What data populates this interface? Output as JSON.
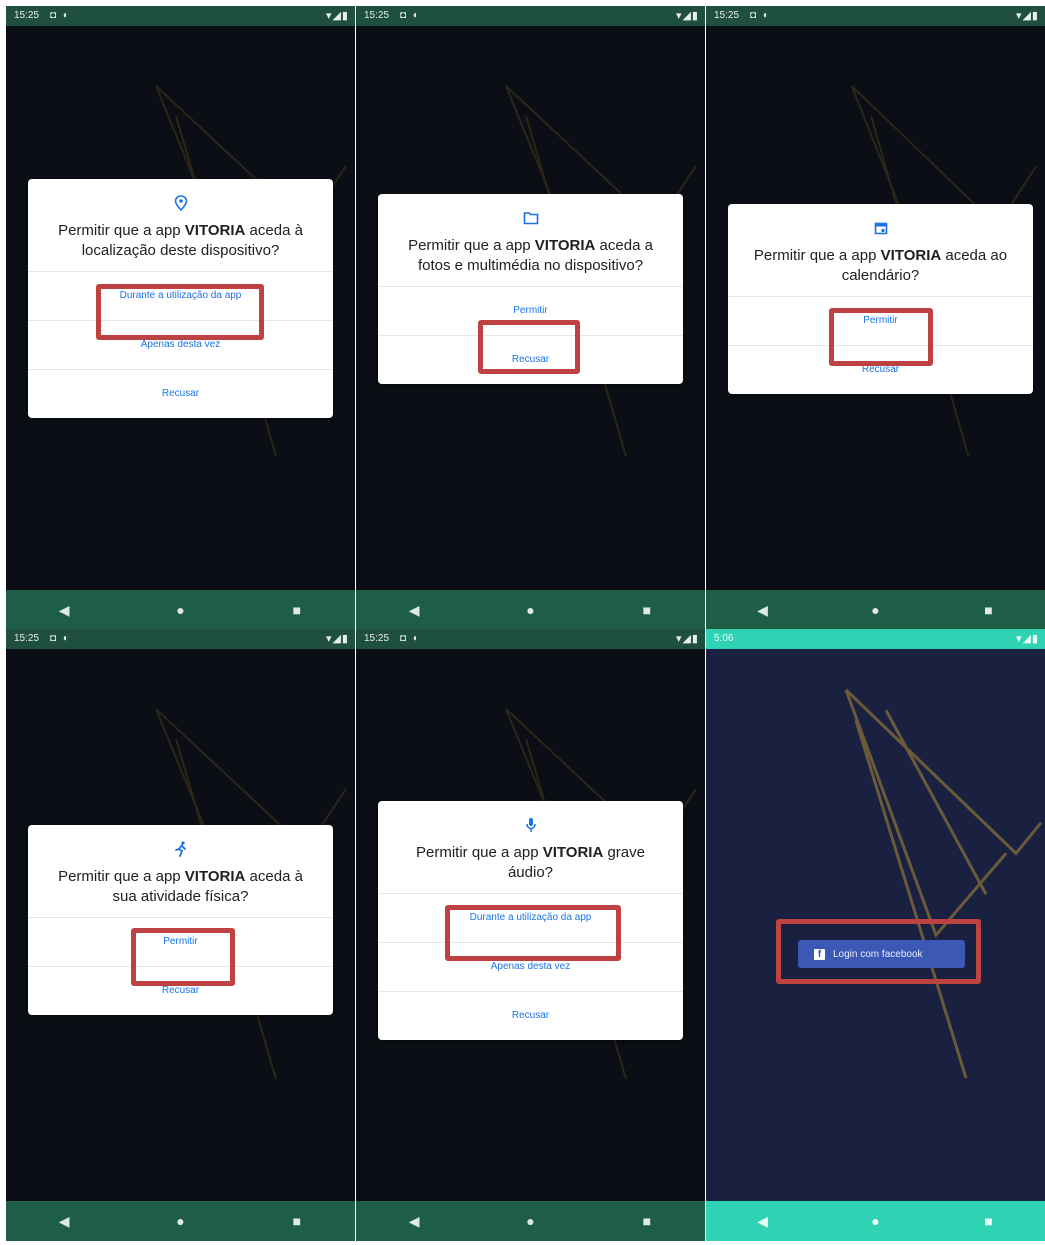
{
  "status": {
    "time": "15:25",
    "time_login": "5:06",
    "icons_left": "◘ ◐",
    "icons_right": "▾◢▮"
  },
  "nav": {
    "back": "◀",
    "home": "●",
    "recents": "■"
  },
  "panels": [
    {
      "question_pre": "Permitir que a app ",
      "app": "VITORIA",
      "question_post": " aceda à localização deste dispositivo?",
      "options": [
        "Durante a utilização da app",
        "Apenas desta vez",
        "Recusar"
      ],
      "icon": "location-icon"
    },
    {
      "question_pre": "Permitir que a app ",
      "app": "VITORIA",
      "question_post": " aceda a fotos e multimédia no dispositivo?",
      "options": [
        "Permitir",
        "Recusar"
      ],
      "icon": "folder-icon"
    },
    {
      "question_pre": "Permitir que a app ",
      "app": "VITORIA",
      "question_post": " aceda ao calendário?",
      "options": [
        "Permitir",
        "Recusar"
      ],
      "icon": "calendar-icon"
    },
    {
      "question_pre": "Permitir que a app ",
      "app": "VITORIA",
      "question_post": " aceda à sua atividade física?",
      "options": [
        "Permitir",
        "Recusar"
      ],
      "icon": "running-icon"
    },
    {
      "question_pre": "Permitir que a app ",
      "app": "VITORIA",
      "question_post": " grave áudio?",
      "options": [
        "Durante a utilização da app",
        "Apenas desta vez",
        "Recusar"
      ],
      "icon": "microphone-icon"
    }
  ],
  "login": {
    "button_label": "Login com facebook",
    "fb_glyph": "f"
  },
  "colors": {
    "highlight": "#bf4242",
    "accent": "#1a73e8",
    "facebook": "#3c58b5",
    "nav_green": "#1e5e46",
    "nav_teal": "#2fd3b3"
  }
}
